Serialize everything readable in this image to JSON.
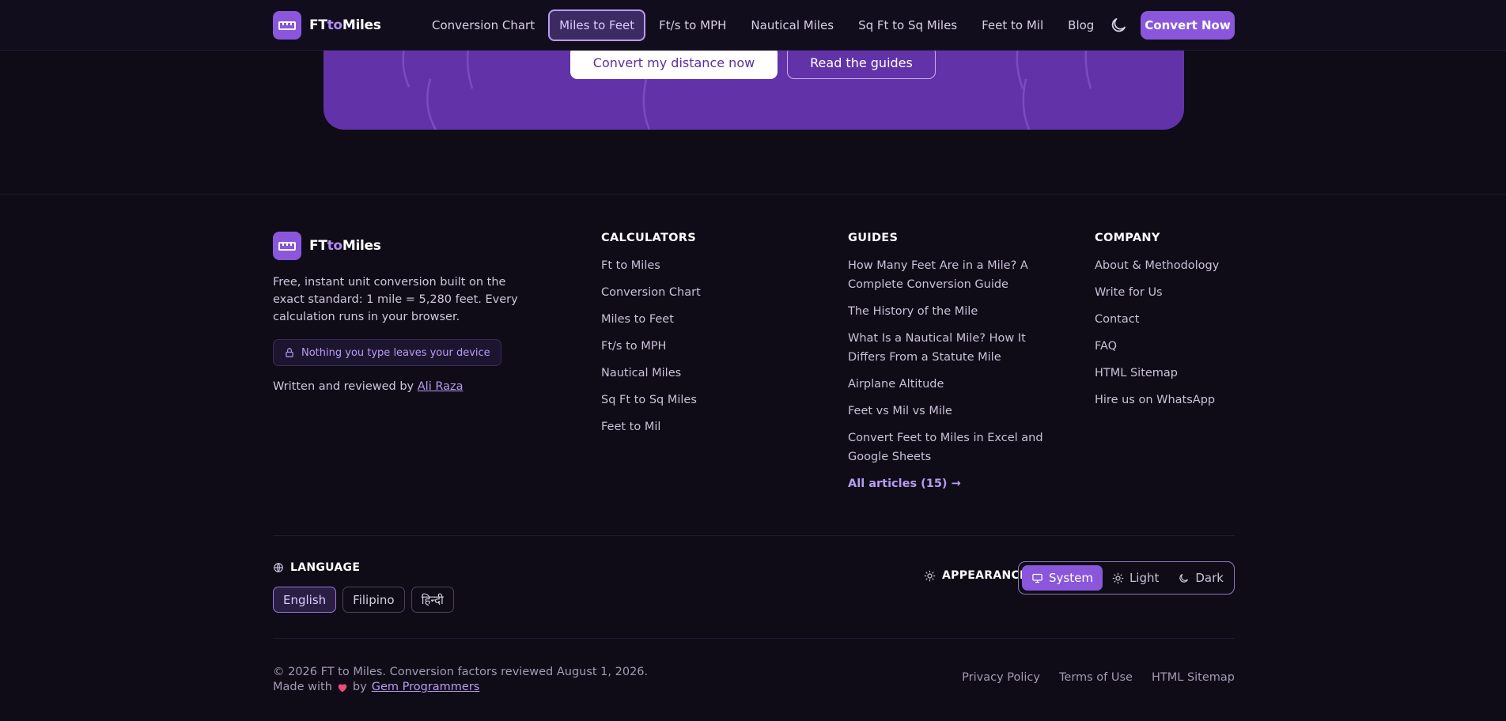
{
  "brand": {
    "name_start": "FT",
    "name_accent": "to",
    "name_end": "Miles"
  },
  "nav": {
    "links": [
      "Conversion Chart",
      "Miles to Feet",
      "Ft/s to MPH",
      "Nautical Miles",
      "Sq Ft to Sq Miles",
      "Feet to Mil",
      "Blog"
    ],
    "active": "Miles to Feet",
    "cta": "Convert Now"
  },
  "hero": {
    "primary_button": "Convert my distance now",
    "secondary_button": "Read the guides"
  },
  "footer": {
    "description": "Free, instant unit conversion built on the exact standard: 1 mile = 5,280 feet. Every calculation runs in your browser.",
    "privacy_badge": "Nothing you type leaves your device",
    "author_prefix": "Written and reviewed by",
    "author_name": "Ali Raza",
    "columns": {
      "calculators": {
        "title": "CALCULATORS",
        "items": [
          "Ft to Miles",
          "Conversion Chart",
          "Miles to Feet",
          "Ft/s to MPH",
          "Nautical Miles",
          "Sq Ft to Sq Miles",
          "Feet to Mil"
        ]
      },
      "guides": {
        "title": "GUIDES",
        "items": [
          "How Many Feet Are in a Mile? A Complete Conversion Guide",
          "The History of the Mile",
          "What Is a Nautical Mile? How It Differs From a Statute Mile",
          "Airplane Altitude",
          "Feet vs Mil vs Mile",
          "Convert Feet to Miles in Excel and Google Sheets"
        ],
        "more": "All articles (15) →"
      },
      "company": {
        "title": "COMPANY",
        "items": [
          "About & Methodology",
          "Write for Us",
          "Contact",
          "FAQ",
          "HTML Sitemap",
          "Hire us on WhatsApp"
        ]
      }
    },
    "language": {
      "label": "LANGUAGE",
      "options": [
        "English",
        "Filipino",
        "हिन्दी"
      ],
      "selected": "English"
    },
    "appearance": {
      "label": "APPEARANCE",
      "options": [
        "System",
        "Light",
        "Dark"
      ],
      "selected": "System"
    },
    "copyright": "© 2026 FT to Miles. Conversion factors reviewed August 1, 2026.",
    "made_with_prefix": "Made with",
    "made_with_by": "by",
    "made_with_name": "Gem Programmers",
    "legal_links": [
      "Privacy Policy",
      "Terms of Use",
      "HTML Sitemap"
    ]
  },
  "colors": {
    "accent": "#8a57dc",
    "hero": "#6233a8",
    "background": "#0f0b17",
    "heart": "#ef4a7a"
  }
}
